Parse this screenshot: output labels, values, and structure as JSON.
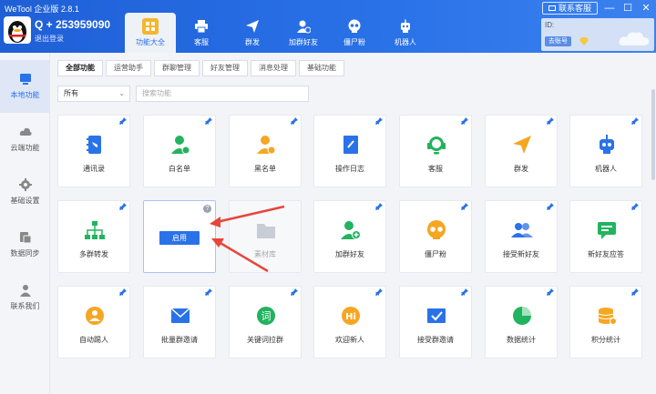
{
  "app": {
    "title": "WeTool 企业版 2.8.1"
  },
  "window": {
    "contact_label": "联系客服"
  },
  "account": {
    "id": "Q + 253959090",
    "logout": "退出登录"
  },
  "nav_tabs": [
    {
      "label": "功能大全",
      "icon": "grid-icon",
      "active": true
    },
    {
      "label": "客服",
      "icon": "headset-icon",
      "active": false
    },
    {
      "label": "群发",
      "icon": "send-icon",
      "active": false
    },
    {
      "label": "加群好友",
      "icon": "add-user-icon",
      "active": false
    },
    {
      "label": "僵尸粉",
      "icon": "skull-icon",
      "active": false
    },
    {
      "label": "机器人",
      "icon": "robot-icon",
      "active": false
    }
  ],
  "user_panel": {
    "id_label": "ID:",
    "badge": "去账号"
  },
  "sidebar": [
    {
      "label": "本地功能",
      "icon": "monitor-icon",
      "active": true
    },
    {
      "label": "云端功能",
      "icon": "cloud-icon",
      "active": false
    },
    {
      "label": "基础设置",
      "icon": "gear-icon",
      "active": false
    },
    {
      "label": "数据同步",
      "icon": "sync-icon",
      "active": false
    },
    {
      "label": "联系我们",
      "icon": "person-icon",
      "active": false
    }
  ],
  "subtabs": [
    "全部功能",
    "运营助手",
    "群聊管理",
    "好友管理",
    "消息处理",
    "基础功能"
  ],
  "filter": {
    "select_value": "所有",
    "search_placeholder": "搜索功能"
  },
  "cards": [
    {
      "label": "通讯录",
      "icon": "contacts-icon",
      "color": "#2a72e8"
    },
    {
      "label": "白名单",
      "icon": "whitelist-user-icon",
      "color": "#22b35e"
    },
    {
      "label": "黑名单",
      "icon": "blacklist-user-icon",
      "color": "#f5a623"
    },
    {
      "label": "操作日志",
      "icon": "log-book-icon",
      "color": "#2a72e8"
    },
    {
      "label": "客服",
      "icon": "headset-icon",
      "color": "#22b35e"
    },
    {
      "label": "群发",
      "icon": "send-icon",
      "color": "#f5a623"
    },
    {
      "label": "机器人",
      "icon": "robot-icon",
      "color": "#2a72e8"
    },
    {
      "label": "多群转发",
      "icon": "org-chart-icon",
      "color": "#22b35e"
    },
    {
      "label": "",
      "icon": "",
      "color": "#2a72e8",
      "enable_label": "启用",
      "help": "?"
    },
    {
      "label": "素材库",
      "icon": "folder-icon",
      "color": "#c8ccd4"
    },
    {
      "label": "加群好友",
      "icon": "add-user-icon",
      "color": "#22b35e"
    },
    {
      "label": "僵尸粉",
      "icon": "skull-icon",
      "color": "#f5a623"
    },
    {
      "label": "接受新好友",
      "icon": "friends-icon",
      "color": "#2a72e8"
    },
    {
      "label": "新好友应答",
      "icon": "chat-reply-icon",
      "color": "#22b35e"
    },
    {
      "label": "自动踢人",
      "icon": "kick-user-icon",
      "color": "#f5a623"
    },
    {
      "label": "批量群邀请",
      "icon": "mail-invite-icon",
      "color": "#2a72e8"
    },
    {
      "label": "关键词拉群",
      "icon": "keyword-icon",
      "color": "#22b35e"
    },
    {
      "label": "欢迎新人",
      "icon": "hi-icon",
      "color": "#f5a623"
    },
    {
      "label": "接受群邀请",
      "icon": "accept-invite-icon",
      "color": "#2a72e8"
    },
    {
      "label": "数据统计",
      "icon": "pie-chart-icon",
      "color": "#22b35e"
    },
    {
      "label": "积分统计",
      "icon": "coins-icon",
      "color": "#f5a623"
    }
  ]
}
